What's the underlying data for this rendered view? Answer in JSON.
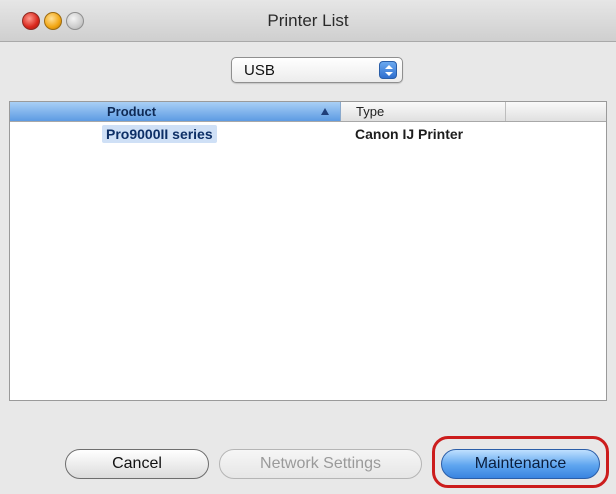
{
  "window": {
    "title": "Printer List"
  },
  "connection_select": {
    "value": "USB"
  },
  "table": {
    "columns": [
      "Product",
      "Type"
    ],
    "rows": [
      {
        "product": "Pro9000II series",
        "type": "Canon IJ Printer"
      }
    ]
  },
  "buttons": {
    "cancel": "Cancel",
    "network_settings": "Network Settings",
    "maintenance": "Maintenance"
  },
  "colors": {
    "accent_blue": "#5d9be3",
    "highlight_red": "#cc1d1d"
  },
  "icons": {
    "close": "close-icon",
    "minimize": "minimize-icon",
    "zoom": "zoom-icon",
    "sort": "sort-ascending-icon",
    "popup": "popup-arrows-icon"
  }
}
